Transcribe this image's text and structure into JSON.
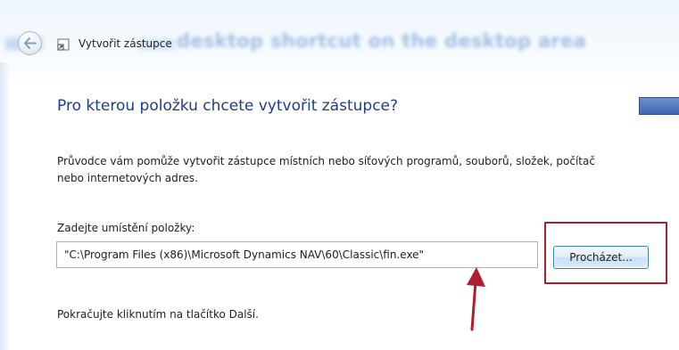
{
  "window": {
    "blurred_caption": "desktop shortcut on the desktop area",
    "title": "Vytvořit zástupce"
  },
  "wizard": {
    "heading": "Pro kterou položku chcete vytvořit zástupce?",
    "description_line1": "Průvodce vám pomůže vytvořit zástupce místních nebo síťových programů, souborů, složek, počítač",
    "description_line2": "nebo internetových adres.",
    "location_label": "Zadejte umístění položky:",
    "location_value": "\"C:\\Program Files (x86)\\Microsoft Dynamics NAV\\60\\Classic\\fin.exe\"",
    "browse_label": "Procházet...",
    "next_hint": "Pokračujte kliknutím na tlačítko Další."
  },
  "annotations": {
    "highlight_color": "#b01f2e",
    "arrow_color": "#b01f2e"
  },
  "icons": {
    "back": "back-arrow-icon",
    "wizard": "shortcut-icon"
  },
  "colors": {
    "heading": "#1e3d8f",
    "accent_button": "#4069b2"
  }
}
